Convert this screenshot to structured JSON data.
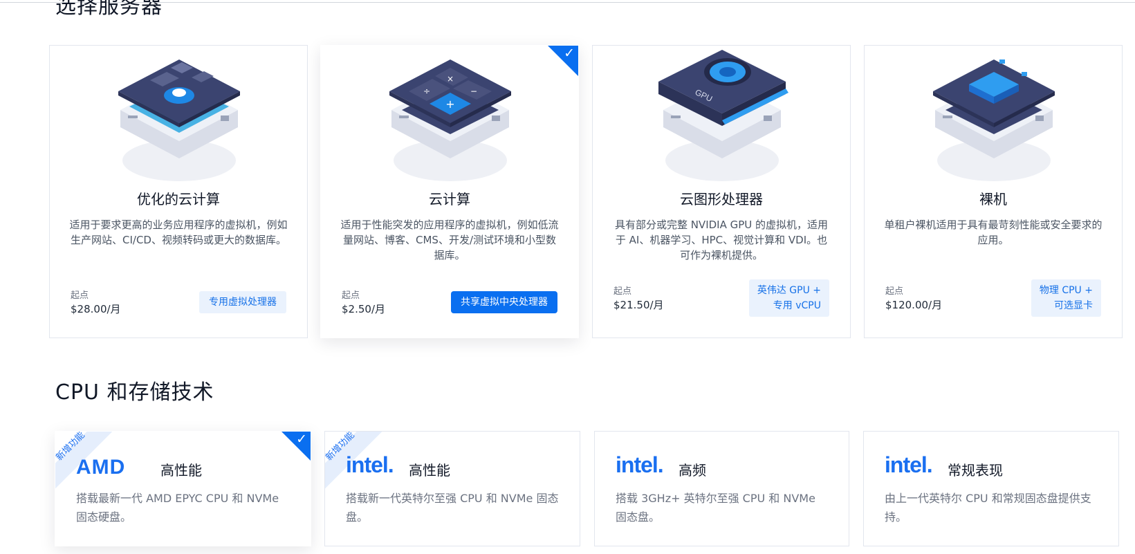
{
  "section_servers": {
    "title": "选择服务器"
  },
  "servers": [
    {
      "name": "优化的云计算",
      "desc": "适用于要求更高的业务应用程序的虚拟机，例如生产网站、CI/CD、视频转码或更大的数据库。",
      "from": "起点",
      "price": "$28.00/月",
      "tag": "专用虚拟处理器",
      "selected": false
    },
    {
      "name": "云计算",
      "desc": "适用于性能突发的应用程序的虚拟机，例如低流量网站、博客、CMS、开发/测试环境和小型数据库。",
      "from": "起点",
      "price": "$2.50/月",
      "tag": "共享虚拟中央处理器",
      "selected": true
    },
    {
      "name": "云图形处理器",
      "desc": "具有部分或完整 NVIDIA GPU 的虚拟机，适用于 AI、机器学习、HPC、视觉计算和 VDI。也可作为裸机提供。",
      "from": "起点",
      "price": "$21.50/月",
      "tag_line1": "英伟达 GPU +",
      "tag_line2": "专用 vCPU",
      "illus_label": "GPU",
      "selected": false
    },
    {
      "name": "裸机",
      "desc": "单租户裸机适用于具有最苛刻性能或安全要求的应用。",
      "from": "起点",
      "price": "$120.00/月",
      "tag_line1": "物理 CPU +",
      "tag_line2": "可选显卡",
      "selected": false
    }
  ],
  "section_tech": {
    "title": "CPU 和存储技术"
  },
  "tech": [
    {
      "logo": "AMD",
      "label": "高性能",
      "desc": "搭载最新一代 AMD EPYC CPU 和 NVMe 固态硬盘。",
      "ribbon": "新增功能",
      "selected": true
    },
    {
      "logo": "intel.",
      "label": "高性能",
      "desc": "搭载新一代英特尔至强 CPU 和 NVMe 固态盘。",
      "ribbon": "新增功能",
      "selected": false
    },
    {
      "logo": "intel.",
      "label": "高频",
      "desc": "搭载 3GHz+ 英特尔至强 CPU 和 NVMe 固态盘。",
      "selected": false
    },
    {
      "logo": "intel.",
      "label": "常规表现",
      "desc": "由上一代英特尔 CPU 和常规固态盘提供支持。",
      "selected": false
    }
  ],
  "colors": {
    "accent": "#0a6ff0",
    "tag_bg": "#eaf2fd",
    "server_dark": "#3b4470",
    "server_light": "#e4e7ef"
  },
  "icons": {
    "check": "checkmark-icon"
  }
}
